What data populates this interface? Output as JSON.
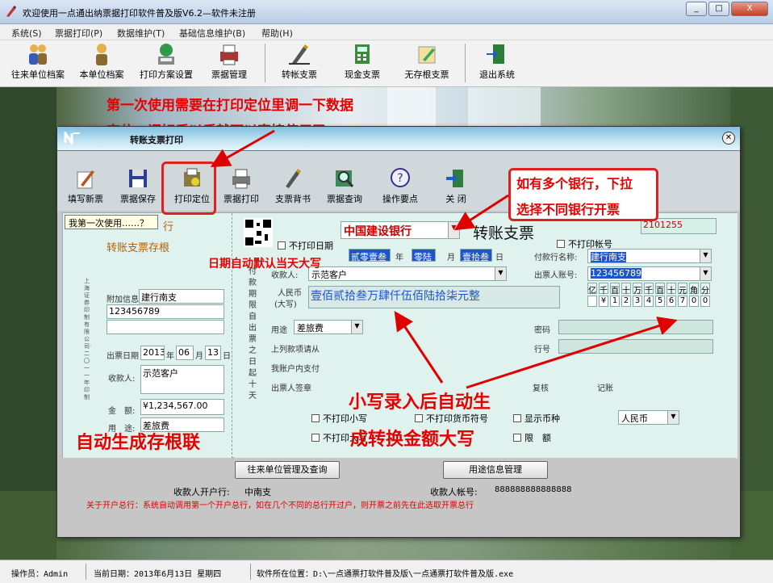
{
  "window": {
    "title": "欢迎使用一点通出纳票据打印软件普及版V6.2—软件未注册",
    "controls": [
      "_",
      "□",
      "X"
    ]
  },
  "menu": [
    "系统(S)",
    "票据打印(P)",
    "数据维护(T)",
    "基础信息维护(B)",
    "帮助(H)"
  ],
  "toolbar": [
    {
      "label": "往来单位档案",
      "icon": "people-icon"
    },
    {
      "label": "本单位档案",
      "icon": "person-icon"
    },
    {
      "label": "打印方案设置",
      "icon": "globe-printer-icon"
    },
    {
      "label": "票据管理",
      "icon": "printer-icon"
    },
    {
      "label": "转帐支票",
      "icon": "pen-icon"
    },
    {
      "label": "现金支票",
      "icon": "calculator-icon"
    },
    {
      "label": "无存根支票",
      "icon": "notepad-icon"
    },
    {
      "label": "退出系统",
      "icon": "exit-door-icon"
    }
  ],
  "dialog": {
    "title": "转账支票打印",
    "toolbar": [
      {
        "label": "填写新票",
        "icon": "write-icon"
      },
      {
        "label": "票据保存",
        "icon": "floppy-icon"
      },
      {
        "label": "打印定位",
        "icon": "locate-icon"
      },
      {
        "label": "票据打印",
        "icon": "printer-icon"
      },
      {
        "label": "支票背书",
        "icon": "pen-icon"
      },
      {
        "label": "票据查询",
        "icon": "magnifier-icon"
      },
      {
        "label": "操作要点",
        "icon": "help-icon"
      },
      {
        "label": "关 闭",
        "icon": "exit-door-icon"
      }
    ],
    "tooltip": "我第一次使用……？",
    "stub": {
      "bank_fragment": "行",
      "title": "转账支票存根",
      "vertical_text": "上海证券印制有限公司·二〇一一年印制",
      "extra_info_label": "附加信息",
      "extra_info_line1": "建行南支",
      "extra_info_line2": "123456789",
      "date_label": "出票日期",
      "year": "2013",
      "year_unit": "年",
      "month": "06",
      "month_unit": "月",
      "day": "13",
      "day_unit": "日",
      "payee_label": "收款人:",
      "payee": "示范客户",
      "amount_label": "金　额:",
      "amount": "¥1,234,567.00",
      "purpose_label": "用　途:",
      "purpose": "差旅费"
    },
    "check": {
      "bank": "中国建设银行",
      "title": "转账支票",
      "number": "2101255",
      "no_print_date": "不打印日期",
      "no_print_account": "不打印帐号",
      "date_year": "贰零壹叁",
      "year_unit": "年",
      "date_month": "零陆",
      "month_unit": "月",
      "date_day": "壹拾叁",
      "day_unit": "日",
      "payer_bank_label": "付款行名称:",
      "payer_bank": "建行南支",
      "payer_account_label": "出票人账号:",
      "payer_account": "123456789",
      "vertical_text": "付款期限自出票之日起十天",
      "payee_label": "收款人:",
      "payee": "示范客户",
      "rmb_label1": "人民币",
      "rmb_label2": "(大写)",
      "amount_upper": "壹佰贰拾叁万肆仟伍佰陆拾柒元整",
      "digit_headers": [
        "亿",
        "千",
        "百",
        "十",
        "万",
        "千",
        "百",
        "十",
        "元",
        "角",
        "分"
      ],
      "digits": [
        "",
        "¥",
        "1",
        "2",
        "3",
        "4",
        "5",
        "6",
        "7",
        "0",
        "0"
      ],
      "purpose_label": "用途",
      "purpose": "差旅费",
      "password_label": "密码",
      "line_number_label": "行号",
      "above_label": "上列款项请从",
      "my_account_label": "我账户内支付",
      "drawer_label": "出票人签章",
      "review_label": "复核",
      "bookkeep_label": "记账"
    },
    "options": {
      "no_print_lower": "不打印小写",
      "no_print_currency": "不打印货币符号",
      "show_currency": "显示币种",
      "currency": "人民币",
      "no_print_upper": "不打印大写",
      "limit": "限　额"
    },
    "bottom": {
      "btn_units": "往来单位管理及查询",
      "btn_purpose": "用途信息管理",
      "payee_bank_label": "收款人开户行:",
      "payee_bank": "中南支",
      "payee_account_label": "收款人帐号:",
      "payee_account": "888888888888888",
      "note": "关于开户总行：系统自动调用第一个开户总行，如在几个不同的总行开过户，则开票之前先在此选取开票总行"
    }
  },
  "annotations": {
    "first_use_line1": "第一次使用需要在打印定位里调一下数据",
    "first_use_line2": "定位，调好后以后就可以直接使用了",
    "multi_bank_line1": "如有多个银行，下拉",
    "multi_bank_line2": "选择不同银行开票",
    "date_default": "日期自动默认当天大写",
    "auto_convert_line1": "小写录入后自动生",
    "auto_convert_line2": "成转换金额大写",
    "auto_stub": "自动生成存根联"
  },
  "status": {
    "operator": "操作员：Admin",
    "date": "当前日期：2013年6月13日  星期四",
    "path": "软件所在位置：D:\\一点通票打软件普及版\\一点通票打软件普及版.exe"
  },
  "colors": {
    "annotation": "#e60000",
    "highlight": "#1e55c8"
  }
}
